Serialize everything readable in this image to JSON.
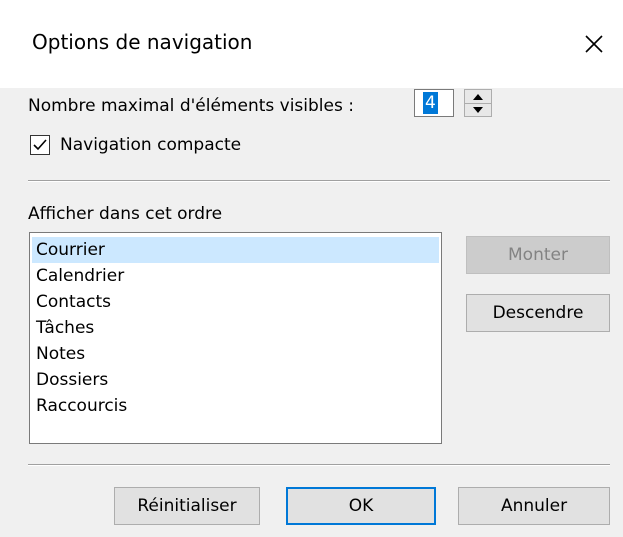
{
  "dialog": {
    "title": "Options de navigation",
    "close_icon": "close-icon"
  },
  "max_items": {
    "label": "Nombre maximal d'éléments visibles :",
    "value": "4"
  },
  "compact": {
    "label": "Navigation compacte",
    "checked": true
  },
  "order": {
    "label": "Afficher dans cet ordre",
    "items": [
      "Courrier",
      "Calendrier",
      "Contacts",
      "Tâches",
      "Notes",
      "Dossiers",
      "Raccourcis"
    ],
    "selected_index": 0
  },
  "buttons": {
    "up": "Monter",
    "down": "Descendre",
    "reset": "Réinitialiser",
    "ok": "OK",
    "cancel": "Annuler"
  },
  "colors": {
    "accent": "#0078d7",
    "selection": "#cce8ff"
  }
}
